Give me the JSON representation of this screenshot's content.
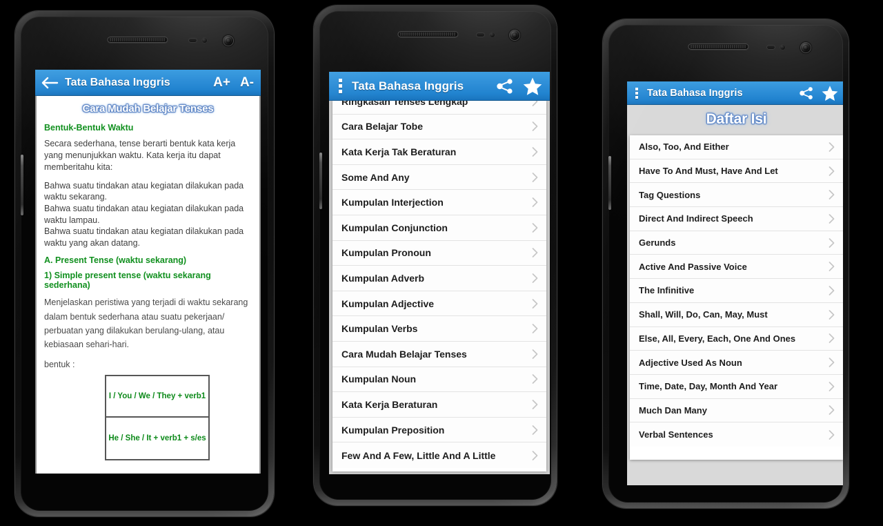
{
  "app": {
    "title": "Tata Bahasa Inggris"
  },
  "phone1": {
    "actionbar": {
      "title": "Tata Bahasa Inggris",
      "back_icon": "back-arrow-icon",
      "increase_font_label": "A+",
      "decrease_font_label": "A-"
    },
    "article": {
      "title": "Cara Mudah Belajar Tenses",
      "heading1": "Bentuk-Bentuk Waktu",
      "para1": "Secara sederhana, tense berarti bentuk kata kerja yang menunjukkan waktu. Kata kerja itu dapat memberitahu kita:",
      "para2": "Bahwa suatu tindakan atau kegiatan dilakukan pada waktu sekarang.\nBahwa suatu tindakan atau kegiatan dilakukan pada waktu lampau.\nBahwa suatu tindakan atau kegiatan dilakukan pada waktu yang akan datang.",
      "heading2": "A. Present Tense (waktu sekarang)",
      "heading3": "1) Simple present tense (waktu sekarang sederhana)",
      "para3": "Menjelaskan peristiwa yang terjadi di waktu sekarang dalam bentuk sederhana atau suatu pekerjaan/ perbuatan yang dilakukan berulang-ulang, atau kebiasaan sehari-hari.",
      "label_bentuk": "bentuk :",
      "formula1": "I / You / We / They + verb1",
      "formula2": "He / She / It + verb1 + s/es"
    }
  },
  "phone2": {
    "actionbar": {
      "title": "Tata Bahasa Inggris",
      "overflow_icon": "overflow-menu-icon",
      "share_icon": "share-icon",
      "star_icon": "star-icon"
    },
    "list_items": [
      "Ringkasan Tenses Lengkap",
      "Cara Belajar Tobe",
      "Kata Kerja Tak Beraturan",
      "Some And Any",
      "Kumpulan Interjection",
      "Kumpulan Conjunction",
      "Kumpulan Pronoun",
      "Kumpulan Adverb",
      "Kumpulan Adjective",
      "Kumpulan Verbs",
      "Cara Mudah Belajar Tenses",
      "Kumpulan Noun",
      "Kata Kerja Beraturan",
      "Kumpulan Preposition",
      "Few And A Few, Little And A Little"
    ]
  },
  "phone3": {
    "actionbar": {
      "title": "Tata Bahasa Inggris",
      "overflow_icon": "overflow-menu-icon",
      "share_icon": "share-icon",
      "star_icon": "star-icon"
    },
    "heading": "Daftar Isi",
    "list_items": [
      "Also, Too, And Either",
      "Have To And Must, Have And Let",
      "Tag Questions",
      "Direct And Indirect Speech",
      "Gerunds",
      "Active And Passive Voice",
      "The Infinitive",
      "Shall, Will, Do, Can, May, Must",
      "Else, All, Every, Each, One And Ones",
      "Adjective Used As Noun",
      "Time, Date, Day, Month And Year",
      "Much Dan Many",
      "Verbal Sentences"
    ]
  },
  "colors": {
    "actionbar_blue": "#2f8fd8",
    "heading_green": "#11901f",
    "page_background": "#000000",
    "list_background": "#d9d9d9"
  }
}
